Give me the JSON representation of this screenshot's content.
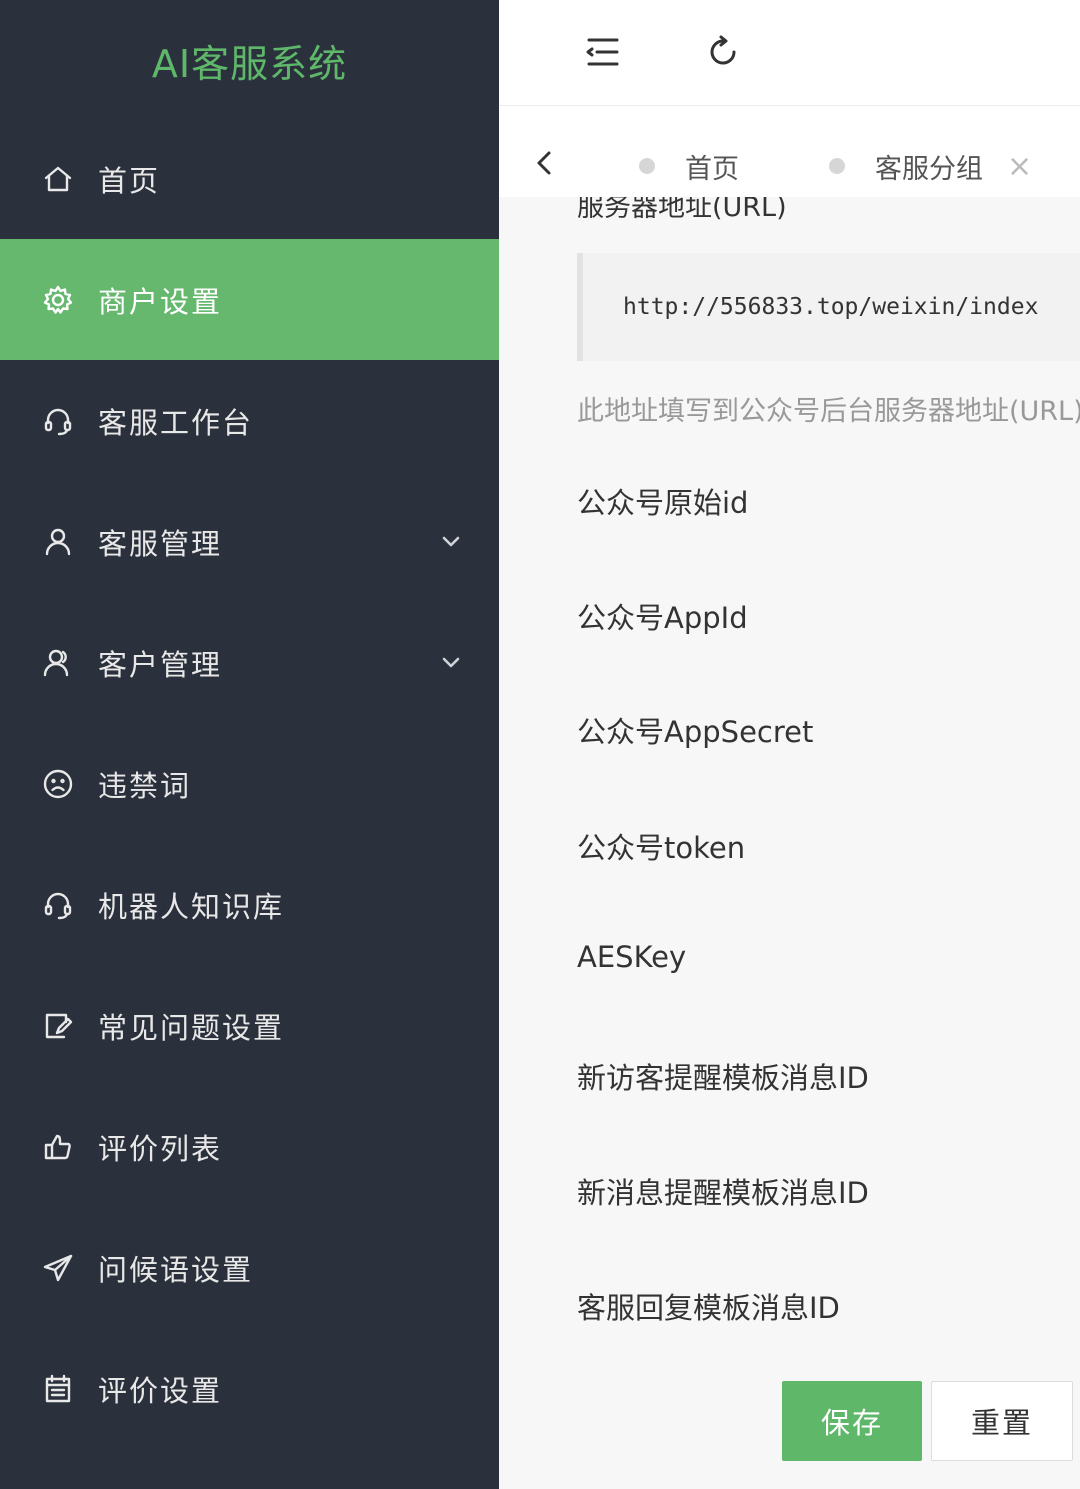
{
  "brand": {
    "title": "AI客服系统",
    "color": "#5fb86a"
  },
  "sidebar": {
    "items": [
      {
        "label": "首页",
        "icon": "home-icon"
      },
      {
        "label": "商户设置",
        "icon": "gear-icon",
        "active": true
      },
      {
        "label": "客服工作台",
        "icon": "headset-icon"
      },
      {
        "label": "客服管理",
        "icon": "user-icon",
        "expandable": true
      },
      {
        "label": "客户管理",
        "icon": "users-icon",
        "expandable": true
      },
      {
        "label": "违禁词",
        "icon": "sad-face-icon"
      },
      {
        "label": "机器人知识库",
        "icon": "headset-icon"
      },
      {
        "label": "常见问题设置",
        "icon": "edit-note-icon"
      },
      {
        "label": "评价列表",
        "icon": "thumbs-up-icon"
      },
      {
        "label": "问候语设置",
        "icon": "send-icon"
      },
      {
        "label": "评价设置",
        "icon": "calendar-icon"
      }
    ]
  },
  "header": {
    "menu_icon": "menu-toggle-icon",
    "refresh_icon": "refresh-icon"
  },
  "tabs": {
    "items": [
      {
        "label": "首页"
      },
      {
        "label": "客服分组",
        "closable": true,
        "close_glyph": "×"
      }
    ]
  },
  "form": {
    "cut_label": "服务器地址(URL)",
    "server_url": "http://556833.top/weixin/index",
    "hint": "此地址填写到公众号后台服务器地址(URL)",
    "fields": [
      "公众号原始id",
      "公众号AppId",
      "公众号AppSecret",
      "公众号token",
      "AESKey",
      "新访客提醒模板消息ID",
      "新消息提醒模板消息ID",
      "客服回复模板消息ID"
    ],
    "save_label": "保存",
    "reset_label": "重置"
  }
}
